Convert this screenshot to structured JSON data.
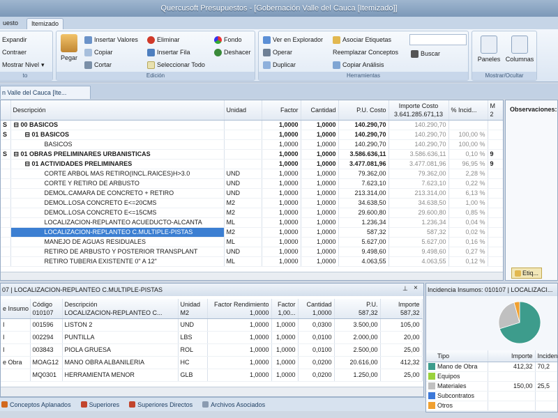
{
  "title": "Quercusoft Presupuestos - [Gobernación Valle del Cauca [Itemizado]]",
  "tabs": [
    "uesto",
    "Itemizado"
  ],
  "ribbon": {
    "g1": {
      "expandir": "Expandir",
      "contraer": "Contraer",
      "mostrar_nivel": "Mostrar Nivel",
      "caption": "to"
    },
    "edicion": {
      "pegar": "Pegar",
      "insertar_valores": "Insertar Valores",
      "copiar": "Copiar",
      "cortar": "Cortar",
      "eliminar": "Eliminar",
      "insertar_fila": "Insertar Fila",
      "seleccionar_todo": "Seleccionar Todo",
      "fondo": "Fondo",
      "deshacer": "Deshacer",
      "caption": "Edición"
    },
    "herramientas": {
      "ver_explorador": "Ver en Explorador",
      "operar": "Operar",
      "duplicar": "Duplicar",
      "asociar_etiquetas": "Asociar Etiquetas",
      "reemplazar_conceptos": "Reemplazar Conceptos",
      "copiar_analisis": "Copiar Análisis",
      "buscar": "Buscar",
      "caption": "Herramientas"
    },
    "mostrar": {
      "paneles": "Paneles",
      "columnas": "Columnas",
      "caption": "Mostrar/Ocultar"
    }
  },
  "doc_tab": "n Valle del Cauca [Ite...",
  "main_grid": {
    "headers": {
      "descripcion": "Descripción",
      "unidad": "Unidad",
      "factor": "Factor",
      "cantidad": "Cantidad",
      "pu_costo": "P.U. Costo",
      "importe_costo": "Importe Costo",
      "importe_total": "3.641.285.671,13",
      "incidencia": "% Incid...",
      "m": "M",
      "m2": "2"
    },
    "rows": [
      {
        "code": "S",
        "desc": "00 BASICOS",
        "unit": "",
        "factor": "1,0000",
        "cant": "1,0000",
        "pu": "140.290,70",
        "imp": "140.290,70",
        "inc": "",
        "m": ""
      },
      {
        "code": "S",
        "desc": "01 BASICOS",
        "unit": "",
        "factor": "1,0000",
        "cant": "1,0000",
        "pu": "140.290,70",
        "imp": "140.290,70",
        "inc": "100,00 %",
        "m": ""
      },
      {
        "code": "",
        "desc": "BASICOS",
        "unit": "",
        "factor": "1,0000",
        "cant": "1,0000",
        "pu": "140.290,70",
        "imp": "140.290,70",
        "inc": "100,00 %",
        "m": ""
      },
      {
        "code": "S",
        "desc": "01 OBRAS PRELIMINARES URBANISTICAS",
        "unit": "",
        "factor": "1,0000",
        "cant": "1,0000",
        "pu": "3.586.636,11",
        "imp": "3.586.636,11",
        "inc": "0,10 %",
        "m": "9"
      },
      {
        "code": "",
        "desc": "01 ACTIVIDADES PRELIMINARES",
        "unit": "",
        "factor": "1,0000",
        "cant": "1,0000",
        "pu": "3.477.081,96",
        "imp": "3.477.081,96",
        "inc": "96,95 %",
        "m": "9"
      },
      {
        "code": "",
        "desc": "CORTE ARBOL MAS RETIRO(INCL.RAICES)H>3.0",
        "unit": "UND",
        "factor": "1,0000",
        "cant": "1,0000",
        "pu": "79.362,00",
        "imp": "79.362,00",
        "inc": "2,28 %",
        "m": ""
      },
      {
        "code": "",
        "desc": "CORTE Y RETIRO DE ARBUSTO",
        "unit": "UND",
        "factor": "1,0000",
        "cant": "1,0000",
        "pu": "7.623,10",
        "imp": "7.623,10",
        "inc": "0,22 %",
        "m": ""
      },
      {
        "code": "",
        "desc": "DEMOL.CAMARA DE CONCRETO + RETIRO",
        "unit": "UND",
        "factor": "1,0000",
        "cant": "1,0000",
        "pu": "213.314,00",
        "imp": "213.314,00",
        "inc": "6,13 %",
        "m": ""
      },
      {
        "code": "",
        "desc": "DEMOL.LOSA CONCRETO  E<=20CMS",
        "unit": "M2",
        "factor": "1,0000",
        "cant": "1,0000",
        "pu": "34.638,50",
        "imp": "34.638,50",
        "inc": "1,00 %",
        "m": ""
      },
      {
        "code": "",
        "desc": "DEMOL.LOSA CONCRETO  E<=15CMS",
        "unit": "M2",
        "factor": "1,0000",
        "cant": "1,0000",
        "pu": "29.600,80",
        "imp": "29.600,80",
        "inc": "0,85 %",
        "m": ""
      },
      {
        "code": "",
        "desc": "LOCALIZACION-REPLANTEO ACUEDUCTO-ALCANTA",
        "unit": "ML",
        "factor": "1,0000",
        "cant": "1,0000",
        "pu": "1.236,34",
        "imp": "1.236,34",
        "inc": "0,04 %",
        "m": ""
      },
      {
        "code": "",
        "desc": "LOCALIZACION-REPLANTEO C.MULTIPLE-PISTAS",
        "unit": "M2",
        "factor": "1,0000",
        "cant": "1,0000",
        "pu": "587,32",
        "imp": "587,32",
        "inc": "0,02 %",
        "m": ""
      },
      {
        "code": "",
        "desc": "MANEJO DE AGUAS RESIDUALES",
        "unit": "ML",
        "factor": "1,0000",
        "cant": "1,0000",
        "pu": "5.627,00",
        "imp": "5.627,00",
        "inc": "0,16 %",
        "m": ""
      },
      {
        "code": "",
        "desc": "RETIRO DE ARBUSTO Y POSTERIOR TRANSPLANT",
        "unit": "UND",
        "factor": "1,0000",
        "cant": "1,0000",
        "pu": "9.498,60",
        "imp": "9.498,60",
        "inc": "0,27 %",
        "m": ""
      },
      {
        "code": "",
        "desc": "RETIRO TUBERIA EXISTENTE  0\" A 12\"",
        "unit": "ML",
        "factor": "1,0000",
        "cant": "1,0000",
        "pu": "4.063,55",
        "imp": "4.063,55",
        "inc": "0,12 %",
        "m": ""
      }
    ]
  },
  "observaciones": "Observaciones:",
  "etiq_tab": "Etiq...",
  "detail": {
    "title": "07 | LOCALIZACION-REPLANTEO C.MULTIPLE-PISTAS",
    "headers": {
      "insumo": "e Insumo",
      "codigo": "Código",
      "codigo_sub": "010107",
      "descripcion": "Descripción",
      "descripcion_sub": "LOCALIZACION-REPLANTEO  C...",
      "unidad": "Unidad",
      "unidad_sub": "M2",
      "factor_rend": "Factor Rendimiento",
      "factor_rend_sub": "1,0000",
      "factor": "Factor",
      "factor_sub": "1,00...",
      "cantidad": "Cantidad",
      "cantidad_sub": "1,0000",
      "pu": "P.U.",
      "pu_sub": "587,32",
      "importe": "Importe",
      "importe_sub": "587,32"
    },
    "rows": [
      {
        "tipo": "I",
        "codigo": "001596",
        "desc": "LISTON 2",
        "unit": "UND",
        "fr": "1,0000",
        "f": "1,0000",
        "cant": "0,0300",
        "pu": "3.500,00",
        "imp": "105,00"
      },
      {
        "tipo": "I",
        "codigo": "002294",
        "desc": "PUNTILLA",
        "unit": "LBS",
        "fr": "1,0000",
        "f": "1,0000",
        "cant": "0,0100",
        "pu": "2.000,00",
        "imp": "20,00"
      },
      {
        "tipo": "I",
        "codigo": "003843",
        "desc": "PIOLA GRUESA",
        "unit": "ROL",
        "fr": "1,0000",
        "f": "1,0000",
        "cant": "0,0100",
        "pu": "2.500,00",
        "imp": "25,00"
      },
      {
        "tipo": "e Obra",
        "codigo": "MOAG12",
        "desc": "MANO OBRA ALBANILERIA",
        "unit": "HC",
        "fr": "1,0000",
        "f": "1,0000",
        "cant": "0,0200",
        "pu": "20.616,00",
        "imp": "412,32"
      },
      {
        "tipo": "",
        "codigo": "MQ0301",
        "desc": "HERRAMIENTA MENOR",
        "unit": "GLB",
        "fr": "1,0000",
        "f": "1,0000",
        "cant": "0,0200",
        "pu": "1.250,00",
        "imp": "25,00"
      }
    ]
  },
  "bottom_tabs": [
    "Conceptos Aplanados",
    "Superiores",
    "Superiores Directos",
    "Archivos Asociados"
  ],
  "incidencia": {
    "title": "Incidencia Insumos: 010107 | LOCALIZACI...",
    "headers": {
      "tipo": "Tipo",
      "importe": "Importe",
      "incidencia": "Inciden..."
    },
    "rows": [
      {
        "tipo": "Mano de Obra",
        "imp": "412,32",
        "inc": "70,2",
        "color": "#3d9c8c"
      },
      {
        "tipo": "Equipos",
        "imp": "",
        "inc": "",
        "color": "#9ad23c"
      },
      {
        "tipo": "Materiales",
        "imp": "150,00",
        "inc": "25,5",
        "color": "#c0c0c0"
      },
      {
        "tipo": "Subcontratos",
        "imp": "",
        "inc": "",
        "color": "#3c78d8"
      },
      {
        "tipo": "Otros",
        "imp": "",
        "inc": "",
        "color": "#f0a030"
      }
    ]
  },
  "chart_data": {
    "type": "pie",
    "categories": [
      "Mano de Obra",
      "Materiales",
      "Otros"
    ],
    "values": [
      70.2,
      25.5,
      4.3
    ]
  }
}
